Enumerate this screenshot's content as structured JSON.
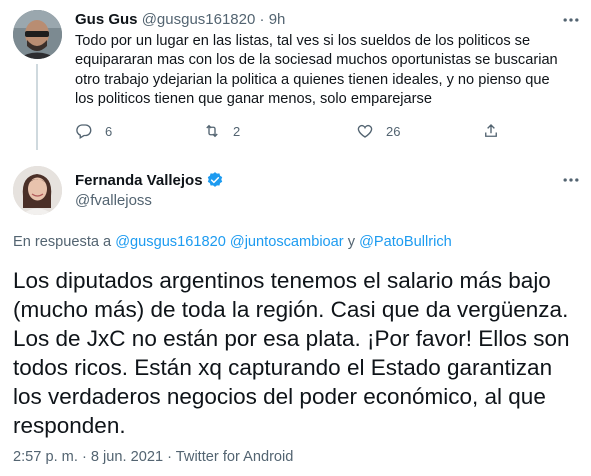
{
  "reply_tweet": {
    "author_name": "Gus Gus",
    "author_handle": "@gusgus161820",
    "separator": "·",
    "time": "9h",
    "text": "Todo por un lugar en las listas, tal ves si los sueldos de los politicos se\nequipararan mas con los de la sociesad muchos oportunistas se buscarian\notro trabajo ydejarian la politica a quienes tienen ideales, y no pienso que\nlos politicos tienen que ganar menos, solo emparejarse",
    "replies": "6",
    "retweets": "2",
    "likes": "26",
    "icons": [
      "reply-icon",
      "retweet-icon",
      "like-icon",
      "share-icon",
      "more-icon"
    ]
  },
  "main_tweet": {
    "author_name": "Fernanda Vallejos",
    "author_handle": "@fvallejoss",
    "verified": true,
    "reply_prefix": "En respuesta a",
    "mention_1": "@gusgus161820",
    "mention_2": "@juntoscambioar",
    "reply_conjunction": "y",
    "mention_3": "@PatoBullrich",
    "text": "Los diputados argentinos tenemos el salario más bajo\n(mucho más) de toda la región. Casi que da vergüenza.\nLos de JxC no están por esa plata. ¡Por favor! Ellos son\ntodos ricos. Están xq capturando el Estado garantizan\nlos verdaderos negocios del poder económico, al que\nresponden.",
    "meta": "2:57 p. m. · 8 jun. 2021 · Twitter for Android"
  },
  "colors": {
    "text": "#0f1419",
    "secondary": "#536471",
    "link": "#1d9bf0",
    "thread_line": "#cfd9de"
  }
}
